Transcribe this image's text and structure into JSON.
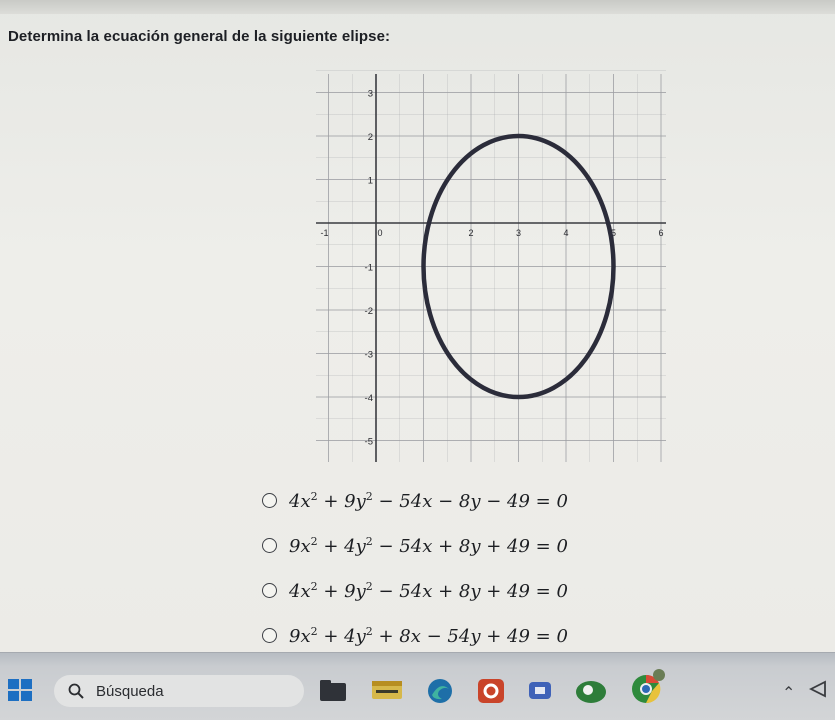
{
  "question": "Determina la ecuación general de la siguiente elipse:",
  "graph": {
    "x_ticks": [
      "-1",
      "0",
      "2",
      "3",
      "4",
      "5",
      "6"
    ],
    "y_ticks": [
      "3",
      "2",
      "1",
      "-1",
      "-2",
      "-3",
      "-4",
      "-5"
    ],
    "ellipse": {
      "center_x": 3,
      "center_y": -1,
      "semi_axis_x": 2,
      "semi_axis_y": 3
    },
    "colors": {
      "ellipse": "#2b2c3a",
      "grid": "#9c9ea2",
      "axis": "#3a3b40"
    }
  },
  "options": [
    {
      "lhs": [
        "4x",
        "2",
        " + 9y",
        "2",
        " − 54x − 8y − 49 = 0"
      ]
    },
    {
      "lhs": [
        "9x",
        "2",
        " + 4y",
        "2",
        " − 54x + 8y + 49 = 0"
      ]
    },
    {
      "lhs": [
        "4x",
        "2",
        " + 9y",
        "2",
        " − 54x + 8y + 49 = 0"
      ]
    },
    {
      "lhs": [
        "9x",
        "2",
        " + 4y",
        "2",
        " + 8x − 54y + 49 = 0"
      ]
    }
  ],
  "taskbar": {
    "search_label": "Búsqueda",
    "apps": [
      "file-explorer-icon",
      "notes-icon",
      "edge-icon",
      "office-icon",
      "media-icon",
      "chat-icon",
      "chrome-icon"
    ],
    "tray": [
      "chevron-up-icon",
      "speaker-icon"
    ]
  }
}
